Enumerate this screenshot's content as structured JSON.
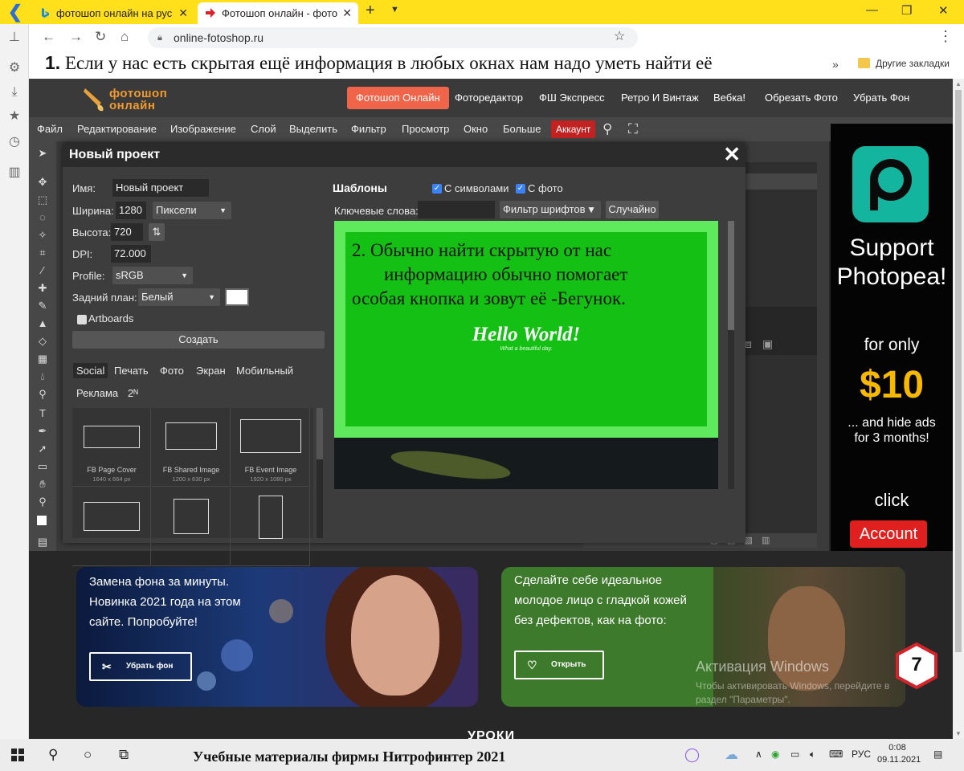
{
  "browser": {
    "tabs": [
      {
        "title": "фотошоп онлайн на рус",
        "active": false
      },
      {
        "title": "Фотошоп онлайн - фото",
        "active": true
      }
    ],
    "url": "online-fotoshop.ru",
    "caption_top": "Если у нас есть скрытая ещё информация в любых окнах нам надо уметь найти её",
    "caption_top_number": "1.",
    "bookmarks_more": "»",
    "other_bookmarks": "Другие закладки"
  },
  "site": {
    "logo_line1": "фотошоп",
    "logo_line2": "онлайн",
    "nav": [
      "Фотошоп Онлайн",
      "Фоторедактор",
      "ФШ Экспресс",
      "Ретро И Винтаж",
      "Вебка!",
      "Обрезать Фото",
      "Убрать Фон"
    ]
  },
  "photopea": {
    "menu": [
      "Файл",
      "Редактирование",
      "Изображение",
      "Слой",
      "Выделить",
      "Фильтр",
      "Просмотр",
      "Окно",
      "Больше"
    ],
    "account_label": "Аккаунт"
  },
  "dialog": {
    "title": "Новый проект",
    "name_label": "Имя:",
    "name_value": "Новый проект",
    "width_label": "Ширина:",
    "width_value": "1280",
    "width_unit": "Пиксели",
    "height_label": "Высота:",
    "height_value": "720",
    "dpi_label": "DPI:",
    "dpi_value": "72.000",
    "profile_label": "Profile:",
    "profile_value": "sRGB",
    "bg_label": "Задний план:",
    "bg_value": "Белый",
    "bg_color": "#ffffff",
    "artboards_label": "Artboards",
    "create_button": "Создать",
    "categories": [
      "Social",
      "Печать",
      "Фото",
      "Экран",
      "Мобильный",
      "Реклама",
      "2ᴺ"
    ],
    "selected_category": "Social",
    "templates": [
      {
        "name": "FB Page Cover",
        "size": "1640 x 664 px"
      },
      {
        "name": "FB Shared Image",
        "size": "1200 x 630 px"
      },
      {
        "name": "FB Event Image",
        "size": "1920 x 1080 px"
      }
    ],
    "templates_title": "Шаблоны",
    "with_symbols": "С символами",
    "with_photo": "С фото",
    "keywords_label": "Ключевые слова:",
    "font_filter": "Фильтр шрифтов",
    "random_button": "Случайно",
    "preview": {
      "note_line1": "2. Обычно найти скрытую от нас",
      "note_line2": "информацию обычно помогает",
      "note_line3": "особая кнопка и зовут её -Бегунок.",
      "hello": "Hello World!",
      "subtitle": "What a beautiful day."
    }
  },
  "ad": {
    "line1": "Support",
    "line2": "Photopea!",
    "for_only": "for only",
    "price": "$10",
    "hide_ads": "... and hide ads",
    "for_months": "for 3 months!",
    "click": "click",
    "button": "Account",
    "brand_color": "#14b59e"
  },
  "promos": [
    {
      "text_line1": "Замена фона за минуты.",
      "text_line2": "Новинка 2021 года на этом",
      "text_line3": "сайте. Попробуйте!",
      "button": "Убрать фон"
    },
    {
      "text_line1": "Сделайте себе идеальное",
      "text_line2": "молодое лицо с гладкой кожей",
      "text_line3": "без дефектов, как на фото:",
      "button": "Открыть"
    }
  ],
  "watermark": {
    "title": "Активация Windows",
    "line1": "Чтобы активировать Windows, перейдите в",
    "line2": "раздел \"Параметры\"."
  },
  "badge_number": "7",
  "lessons_label": "УРОКИ",
  "taskbar": {
    "caption": "Учебные материалы фирмы Нитрофинтер 2021",
    "lang": "РУС",
    "time": "0:08",
    "date": "09.11.2021"
  }
}
